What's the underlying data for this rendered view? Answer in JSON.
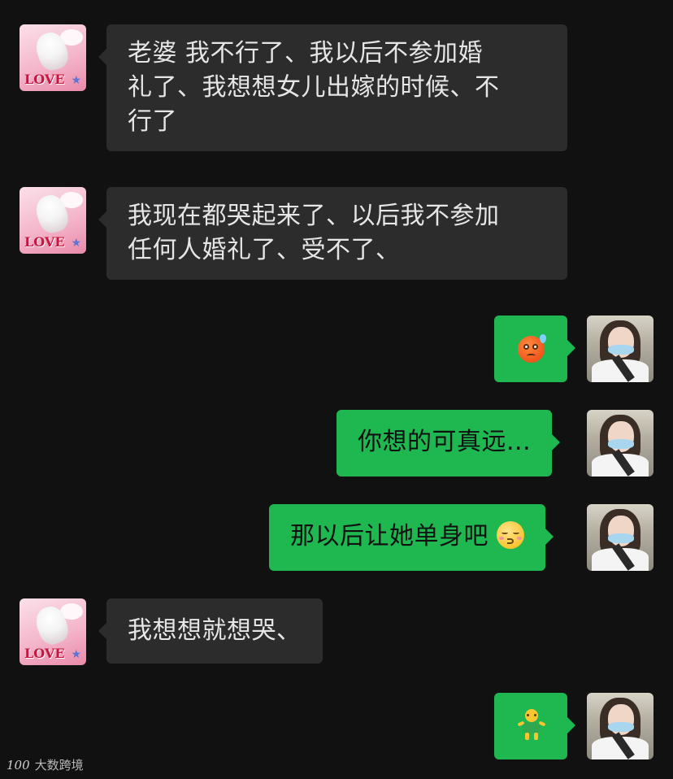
{
  "messages": [
    {
      "side": "left",
      "text_lines": [
        "老婆 我不行了、我以后不参加婚",
        "礼了、我想想女儿出嫁的时候、不",
        "行了"
      ]
    },
    {
      "side": "left",
      "text_lines": [
        "我现在都哭起来了、以后我不参加",
        "任何人婚礼了、受不了、"
      ]
    },
    {
      "side": "right",
      "emoji": "sweat-frowning-face-emoji"
    },
    {
      "side": "right",
      "text": "你想的可真远..."
    },
    {
      "side": "right",
      "text": "那以后让她单身吧",
      "emoji": "kissing-closed-eyes-emoji"
    },
    {
      "side": "left",
      "text": "我想想就想哭、"
    },
    {
      "side": "right",
      "emoji": "dancing-figure-emoji"
    }
  ],
  "left_avatar": {
    "caption": "LOVE"
  },
  "watermark": {
    "logo": "100",
    "text": "大数跨境"
  },
  "colors": {
    "background": "#111111",
    "left_bubble": "#2c2c2c",
    "right_bubble": "#1fb750"
  }
}
